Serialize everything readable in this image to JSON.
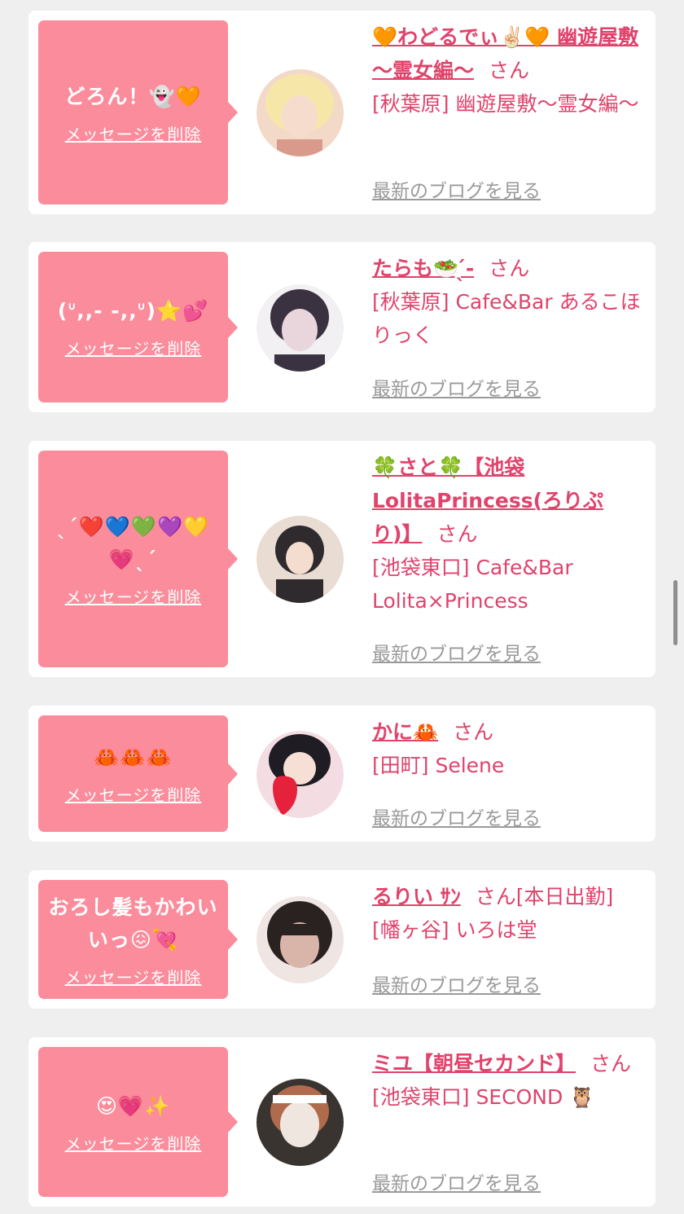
{
  "items": [
    {
      "message": "どろん！👻🧡",
      "delete_label": "メッセージを削除",
      "name": "🧡わどるでぃ✌🏻🧡 幽遊屋敷 〜霊女編〜",
      "honorific": "さん",
      "status": "",
      "shop": "[秋葉原] 幽遊屋敷〜霊女編〜",
      "blog_label": "最新のブログを見る",
      "avatar_colors": [
        "#f3d9c8",
        "#d99a8c",
        "#f6e7a8"
      ]
    },
    {
      "message": "(ᐡ,,- -,,ᐡ)⭐️💕",
      "delete_label": "メッセージを削除",
      "name": "たらも🥗 ̖́-",
      "honorific": "さん",
      "status": "",
      "shop": "[秋葉原] Cafe&Bar あるこほりっく",
      "blog_label": "最新のブログを見る",
      "avatar_colors": [
        "#f2f0f3",
        "#3a3240",
        "#e8d6dc"
      ]
    },
    {
      "message": "ˎˊ❤️💙💚💜💛💗ˎˊ",
      "delete_label": "メッセージを削除",
      "name": "🍀さと🍀【池袋LolitaPrincess(ろりぷり)】",
      "honorific": "さん",
      "status": "",
      "shop": "[池袋東口] Cafe&Bar Lolita×Princess",
      "blog_label": "最新のブログを見る",
      "avatar_colors": [
        "#e9dcd2",
        "#2e2a2e",
        "#c89a86"
      ]
    },
    {
      "message": "🦀🦀🦀",
      "delete_label": "メッセージを削除",
      "name": "かに🦀",
      "honorific": "さん",
      "status": "",
      "shop": "[田町] Selene",
      "blog_label": "最新のブログを見る",
      "avatar_colors": [
        "#f4dde2",
        "#1f1c24",
        "#e5213c"
      ]
    },
    {
      "message": "おろし髪もかわいいっ😖💘",
      "delete_label": "メッセージを削除",
      "name": "るりい ｻﾝ",
      "honorific": "さん",
      "status": "[本日出勤]",
      "shop": "[幡ヶ谷] いろは堂",
      "blog_label": "最新のブログを見る",
      "avatar_colors": [
        "#efe6e4",
        "#2a2220",
        "#d9b5a9"
      ]
    },
    {
      "message": "😍💗✨",
      "delete_label": "メッセージを削除",
      "name": "ミユ【朝昼セカンド】",
      "honorific": "さん",
      "status": "",
      "shop": "[池袋東口] SECOND 🦉",
      "blog_label": "最新のブログを見る",
      "avatar_colors": [
        "#f0e6e0",
        "#b06a4c",
        "#3a3430"
      ]
    }
  ]
}
